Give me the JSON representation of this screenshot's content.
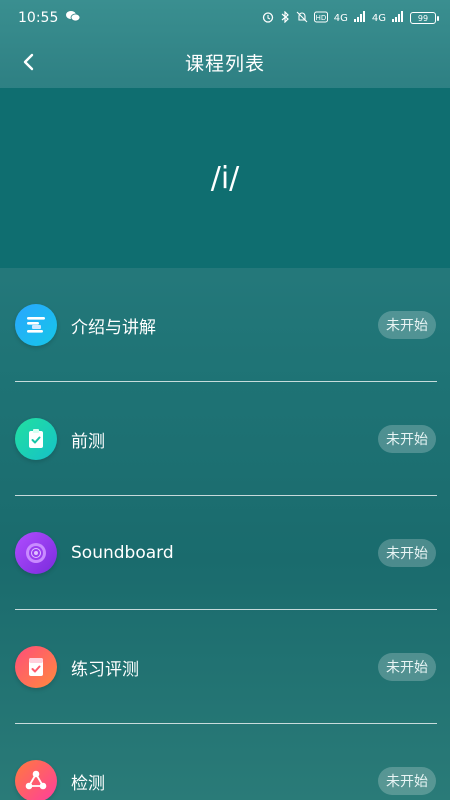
{
  "status_bar": {
    "time": "10:55",
    "network_1": "4G",
    "network_2": "4G",
    "battery_level": "99"
  },
  "header": {
    "title": "课程列表"
  },
  "hero": {
    "text": "/i/"
  },
  "items": [
    {
      "label": "介绍与讲解",
      "status": "未开始",
      "icon": "lines-icon",
      "color_from": "#2aa6ff",
      "color_to": "#15c7e8"
    },
    {
      "label": "前测",
      "status": "未开始",
      "icon": "clipboard-check-icon",
      "color_from": "#22e0a0",
      "color_to": "#15c1c8"
    },
    {
      "label": "Soundboard",
      "status": "未开始",
      "icon": "speaker-icon",
      "color_from": "#b04dff",
      "color_to": "#7a2bdc"
    },
    {
      "label": "练习评测",
      "status": "未开始",
      "icon": "notebook-check-icon",
      "color_from": "#ff4d7a",
      "color_to": "#ff8a3d"
    },
    {
      "label": "检测",
      "status": "未开始",
      "icon": "share-nodes-icon",
      "color_from": "#ff7a3d",
      "color_to": "#ff3d9e"
    }
  ]
}
